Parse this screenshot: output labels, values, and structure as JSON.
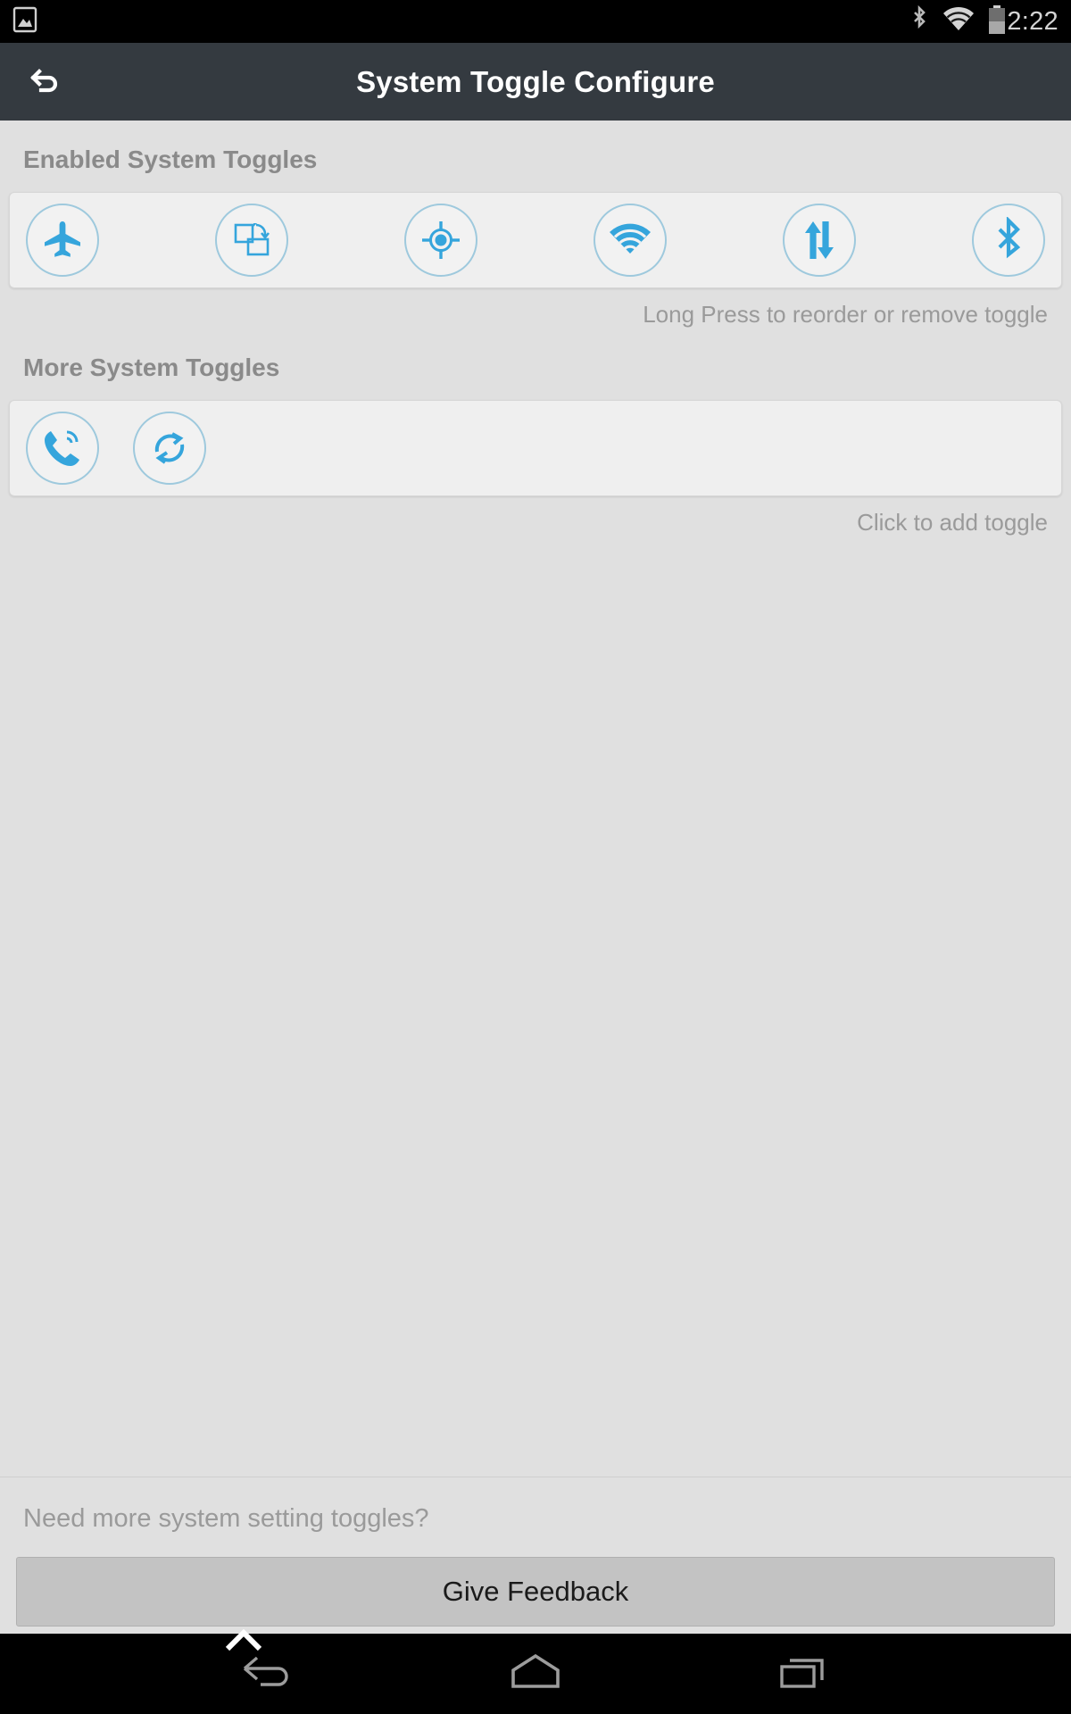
{
  "statusbar": {
    "time": "2:22",
    "left_icons": [
      {
        "name": "screenshot-image-icon"
      }
    ],
    "right_icons": [
      {
        "name": "bluetooth-status-icon"
      },
      {
        "name": "wifi-status-icon"
      },
      {
        "name": "battery-status-icon"
      }
    ]
  },
  "appbar": {
    "title": "System Toggle Configure",
    "back_icon": "back-undo-arrow-icon"
  },
  "enabled_section": {
    "heading": "Enabled System Toggles",
    "hint": "Long Press to reorder or remove toggle",
    "toggles": [
      {
        "name": "airplane-mode-toggle",
        "icon": "airplane-icon"
      },
      {
        "name": "auto-rotate-toggle",
        "icon": "screen-rotation-icon"
      },
      {
        "name": "location-toggle",
        "icon": "location-crosshair-icon"
      },
      {
        "name": "wifi-toggle",
        "icon": "wifi-icon"
      },
      {
        "name": "mobile-data-toggle",
        "icon": "data-transfer-arrows-icon"
      },
      {
        "name": "bluetooth-toggle",
        "icon": "bluetooth-icon"
      }
    ]
  },
  "more_section": {
    "heading": "More System Toggles",
    "hint": "Click to add toggle",
    "toggles": [
      {
        "name": "ringer-toggle",
        "icon": "phone-ring-icon"
      },
      {
        "name": "auto-sync-toggle",
        "icon": "sync-refresh-icon"
      }
    ]
  },
  "footer": {
    "question": "Need more system setting toggles?",
    "feedback_label": "Give Feedback"
  },
  "navbar": {
    "back": "nav-back-icon",
    "home": "nav-home-icon",
    "recents": "nav-recents-icon"
  },
  "colors": {
    "accent": "#35a5dc",
    "toggle_ring": "#9ec9dd",
    "appbar_bg": "#343a40",
    "page_bg": "#e0e0e0",
    "card_bg": "#efefef",
    "heading_text": "#8a8a8a",
    "hint_text": "#9a9a9a",
    "feedback_bg": "#c3c3c3"
  }
}
